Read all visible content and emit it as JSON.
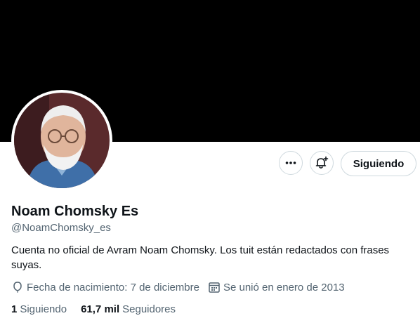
{
  "profile": {
    "name": "Noam Chomsky Es",
    "handle": "@NoamChomsky_es",
    "bio": "Cuenta no oficial de Avram Noam Chomsky. Los tuit están redactados con frases suyas.",
    "birth": "Fecha de nacimiento: 7 de diciembre",
    "joined": "Se unió en enero de 2013"
  },
  "actions": {
    "more_icon": "more-icon",
    "bell_icon": "bell-plus-icon",
    "follow_label": "Siguiendo"
  },
  "counts": {
    "following_num": "1",
    "following_label": "Siguiendo",
    "followers_num": "61,7 mil",
    "followers_label": "Seguidores"
  },
  "colors": {
    "banner": "#000000",
    "text_primary": "#0f1419",
    "text_secondary": "#536471",
    "border": "#cfd9de"
  }
}
